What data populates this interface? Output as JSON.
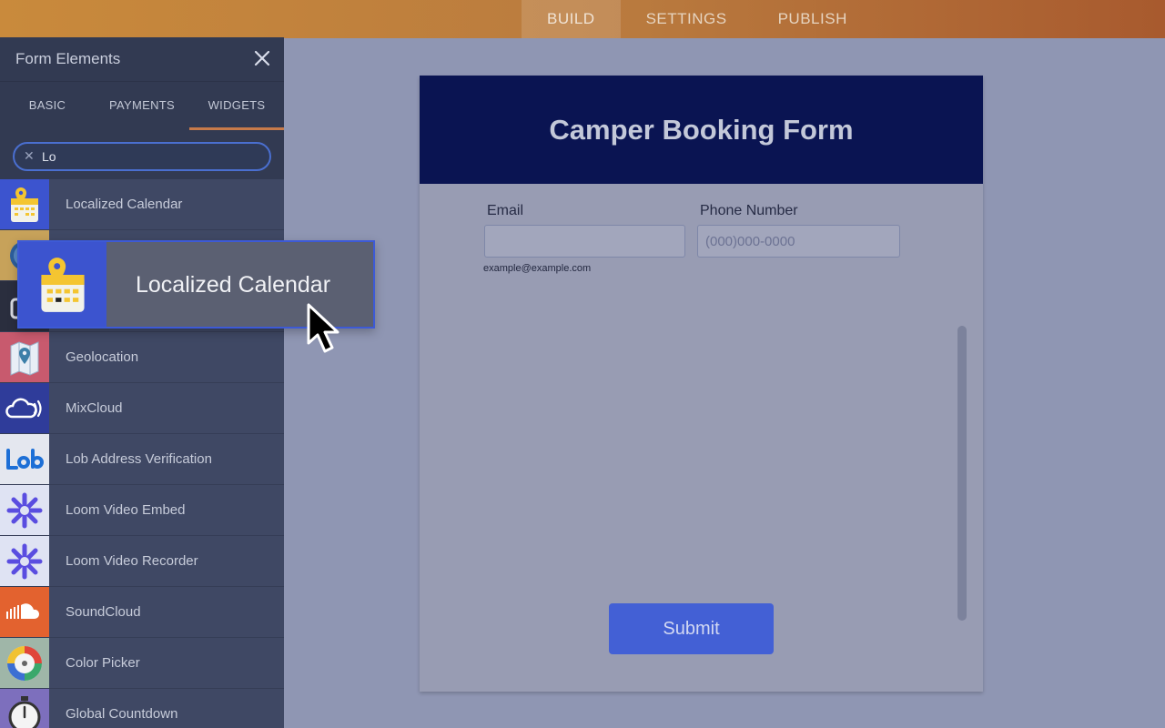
{
  "topnav": {
    "tabs": [
      "BUILD",
      "SETTINGS",
      "PUBLISH"
    ],
    "active": "BUILD"
  },
  "sidebar": {
    "title": "Form Elements",
    "tabs": [
      "BASIC",
      "PAYMENTS",
      "WIDGETS"
    ],
    "active_tab": "WIDGETS",
    "search": {
      "value": "Lo"
    },
    "items": [
      {
        "label": "Localized Calendar",
        "icon": "calendar-pin-icon"
      },
      {
        "label": "",
        "icon": "compass-icon"
      },
      {
        "label": "",
        "icon": "camera-icon"
      },
      {
        "label": "Geolocation",
        "icon": "map-pin-icon"
      },
      {
        "label": "MixCloud",
        "icon": "mixcloud-icon"
      },
      {
        "label": "Lob Address Verification",
        "icon": "lob-logo-icon"
      },
      {
        "label": "Loom Video Embed",
        "icon": "loom-icon"
      },
      {
        "label": "Loom Video Recorder",
        "icon": "loom-icon"
      },
      {
        "label": "SoundCloud",
        "icon": "soundcloud-icon"
      },
      {
        "label": "Color Picker",
        "icon": "color-wheel-icon"
      },
      {
        "label": "Global Countdown",
        "icon": "stopwatch-icon"
      }
    ]
  },
  "drag_ghost": {
    "label": "Localized Calendar",
    "icon": "calendar-pin-icon"
  },
  "form": {
    "title": "Camper Booking Form",
    "email": {
      "label": "Email",
      "value": "",
      "sublabel": "example@example.com"
    },
    "phone": {
      "label": "Phone Number",
      "placeholder": "(000)000-0000"
    },
    "submit_label": "Submit"
  },
  "colors": {
    "header_bg": "#0a1452",
    "submit_bg": "#4360d5",
    "accent": "#c77a4a",
    "topbar": "#b97a3e"
  }
}
